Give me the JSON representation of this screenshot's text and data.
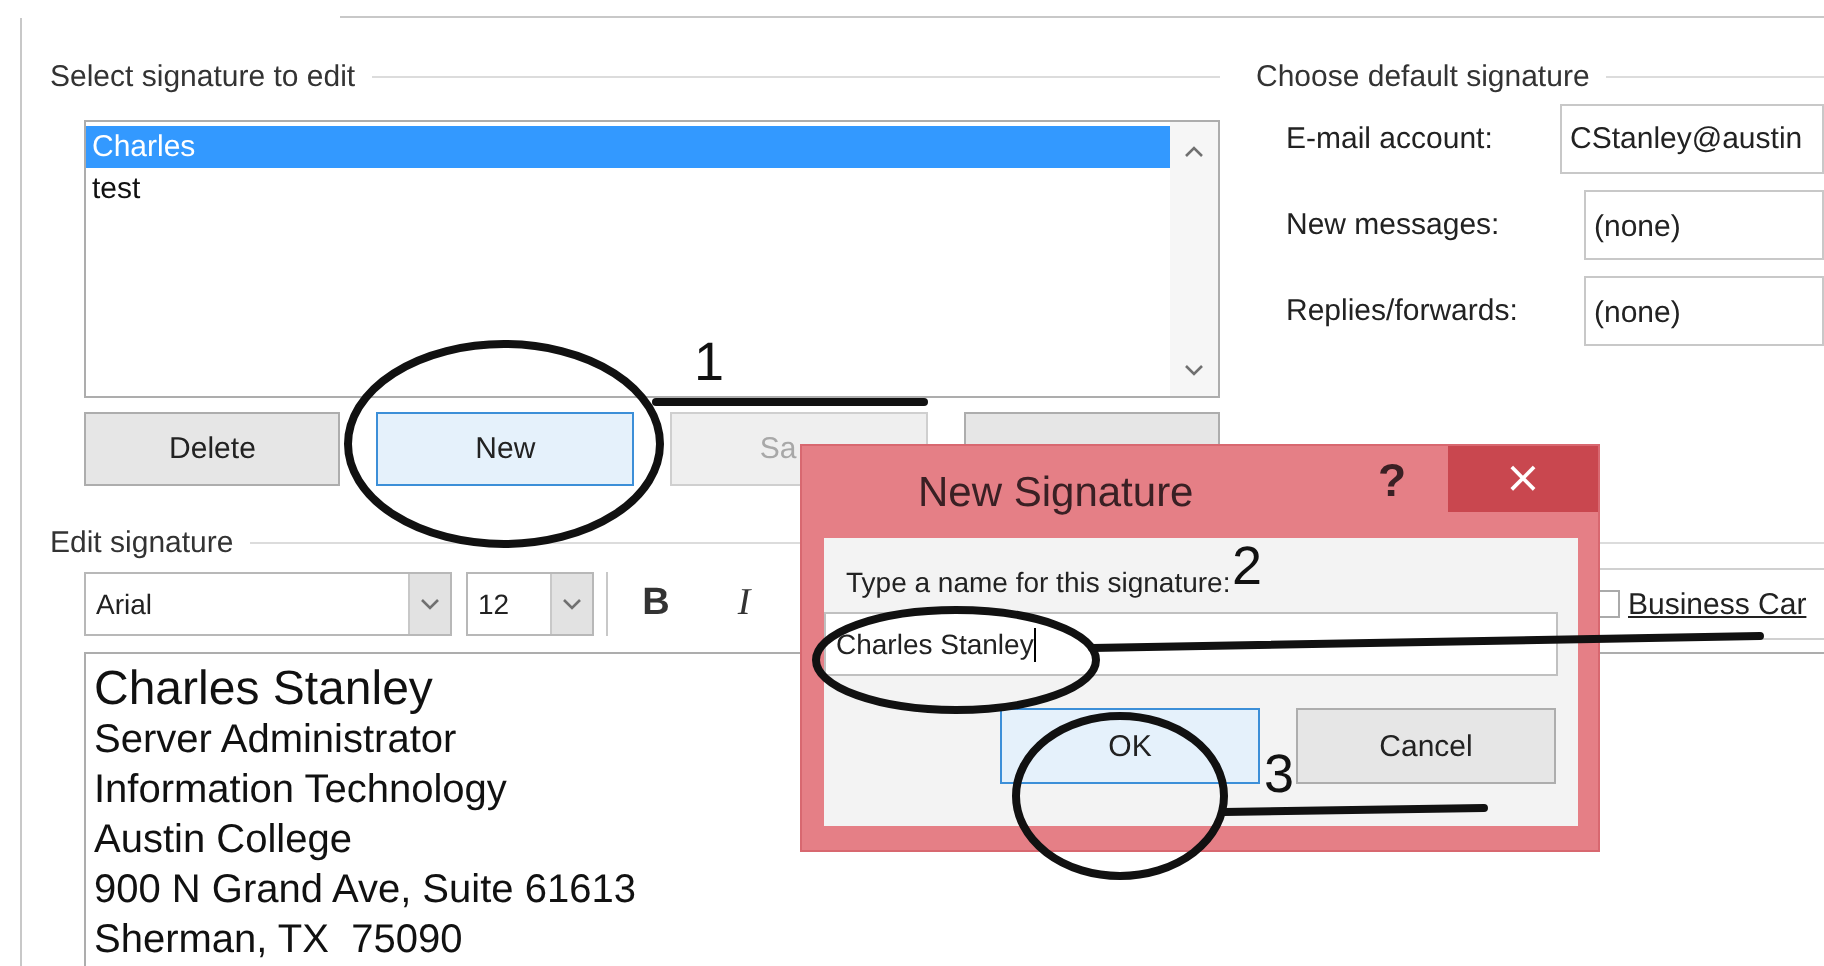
{
  "select_group": {
    "title": "Select signature to edit",
    "signatures": [
      {
        "name": "Charles",
        "selected": true
      },
      {
        "name": "test",
        "selected": false
      }
    ],
    "buttons": [
      {
        "label": "Delete",
        "focused": false,
        "disabled": false
      },
      {
        "label": "New",
        "focused": true,
        "disabled": false
      },
      {
        "label": "Sa",
        "focused": false,
        "disabled": true
      },
      {
        "focused": false,
        "disabled": false
      }
    ]
  },
  "default_group": {
    "title": "Choose default signature",
    "fields": [
      {
        "label": "E-mail account:",
        "value": "CStanley@austin"
      },
      {
        "label": "New messages:",
        "value": "(none)"
      },
      {
        "label": "Replies/forwards:",
        "value": "(none)"
      }
    ]
  },
  "edit_group": {
    "title": "Edit signature",
    "font": "Arial",
    "size": "12",
    "format_buttons": [
      {
        "label": "B",
        "kind": "bold"
      },
      {
        "label": "I",
        "kind": "italic"
      }
    ],
    "business_card": "Business Car",
    "business_card_checked": false,
    "lines": [
      {
        "text": "Charles Stanley",
        "kind": "name"
      },
      {
        "text": "Server Administrator",
        "kind": "line"
      },
      {
        "text": "Information Technology",
        "kind": "line"
      },
      {
        "text": "Austin College",
        "kind": "line"
      },
      {
        "text": "900 N Grand Ave, Suite 61613",
        "kind": "line"
      },
      {
        "text": "Sherman, TX  75090",
        "kind": "line"
      }
    ]
  },
  "popup": {
    "title": "New Signature",
    "help": "?",
    "close": "×",
    "prompt": "Type a name for this signature:",
    "value": "Charles Stanley",
    "buttons": [
      {
        "label": "OK",
        "default": true
      },
      {
        "label": "Cancel",
        "default": false
      }
    ]
  },
  "annotations": [
    {
      "label": "1"
    },
    {
      "label": "2"
    },
    {
      "label": "3"
    }
  ]
}
